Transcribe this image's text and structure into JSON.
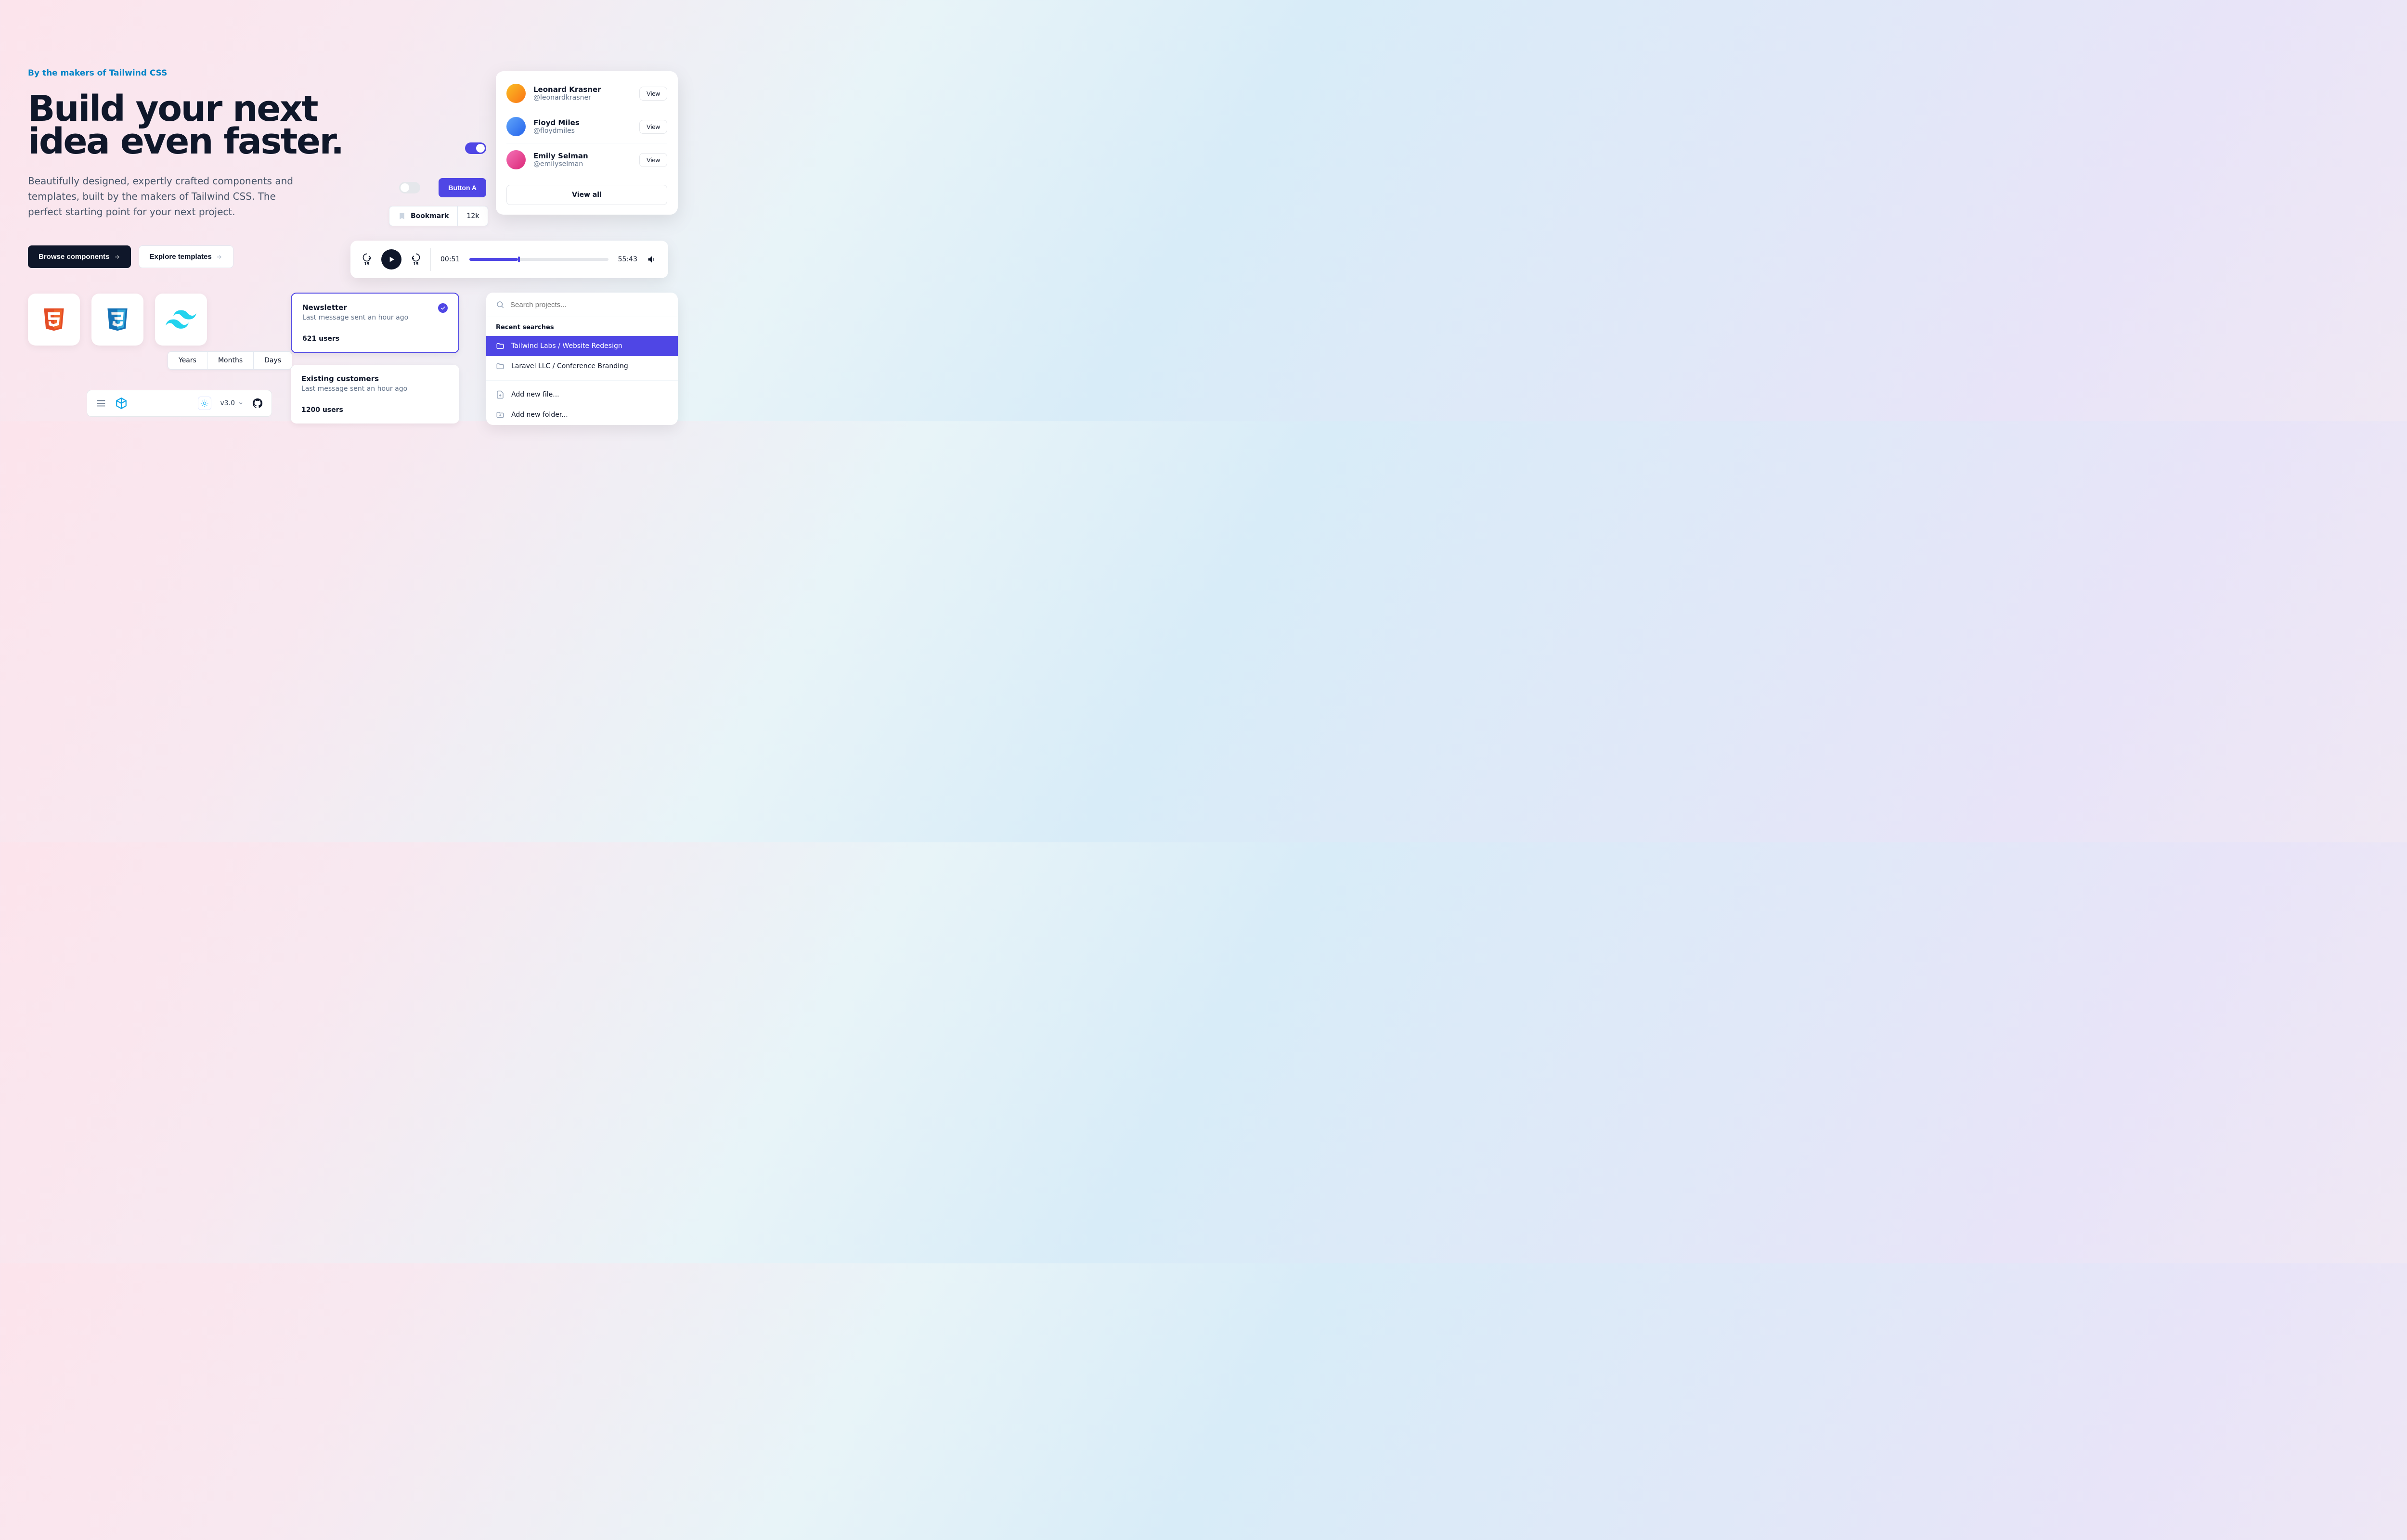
{
  "hero": {
    "eyebrow": "By the makers of Tailwind CSS",
    "headline": "Build your next idea even faster.",
    "subhead": "Beautifully designed, expertly crafted components and templates, built by the makers of Tailwind CSS. The perfect starting point for your next project.",
    "primary_cta": "Browse components",
    "secondary_cta": "Explore templates"
  },
  "segmented": {
    "items": [
      "Years",
      "Months",
      "Days"
    ]
  },
  "toolbar": {
    "version": "v3.0"
  },
  "button_a": "Button A",
  "bookmark": {
    "label": "Bookmark",
    "count": "12k"
  },
  "people": {
    "items": [
      {
        "name": "Leonard Krasner",
        "handle": "@leonardkrasner",
        "action": "View"
      },
      {
        "name": "Floyd Miles",
        "handle": "@floydmiles",
        "action": "View"
      },
      {
        "name": "Emily Selman",
        "handle": "@emilyselman",
        "action": "View"
      }
    ],
    "view_all": "View all"
  },
  "player": {
    "current": "00:51",
    "total": "55:43",
    "skip_back": "15",
    "skip_fwd": "15"
  },
  "cards": [
    {
      "title": "Newsletter",
      "sub": "Last message sent an hour ago",
      "users": "621 users"
    },
    {
      "title": "Existing customers",
      "sub": "Last message sent an hour ago",
      "users": "1200 users"
    }
  ],
  "search": {
    "placeholder": "Search projects...",
    "recent_label": "Recent searches",
    "projects": [
      "Tailwind Labs / Website Redesign",
      "Laravel LLC / Conference Branding"
    ],
    "actions": [
      "Add new file...",
      "Add new folder..."
    ]
  },
  "colors": {
    "indigo": "#4f46e5",
    "sky": "#0284c7"
  },
  "logos": [
    "html5",
    "css3",
    "tailwind"
  ]
}
